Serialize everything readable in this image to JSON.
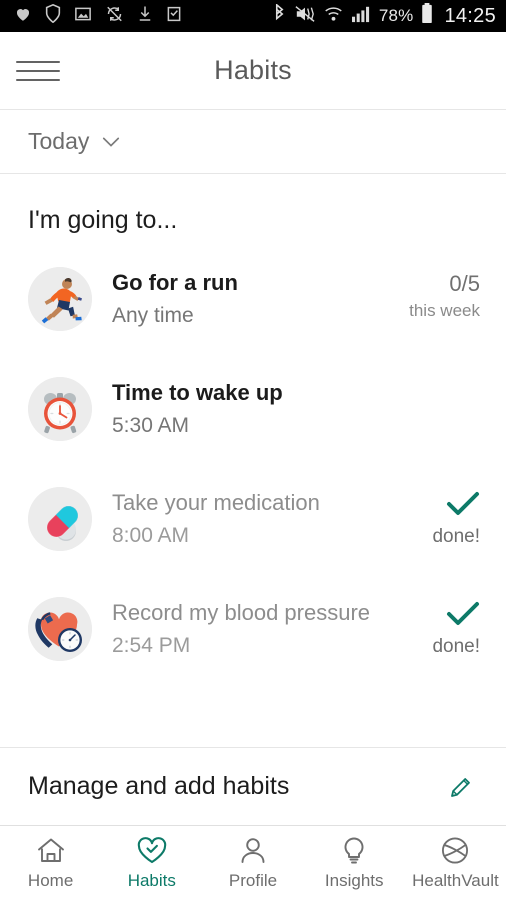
{
  "statusbar": {
    "left_icons": [
      "heart-icon",
      "shield-icon",
      "image-icon",
      "sync-disabled-icon",
      "download-icon",
      "clipboard-check-icon"
    ],
    "right_icons": [
      "bluetooth-icon",
      "vibrate-mute-icon",
      "wifi-icon",
      "cellular-signal-icon"
    ],
    "battery_percent": "78%",
    "battery_icon": "battery-icon",
    "clock": "14:25"
  },
  "appbar": {
    "menu_icon": "hamburger-menu-icon",
    "title": "Habits"
  },
  "datebar": {
    "label": "Today",
    "chevron_icon": "chevron-down-icon"
  },
  "main": {
    "section_title": "I'm going to...",
    "habits": [
      {
        "icon": "running-person-icon",
        "name": "Go for a run",
        "time": "Any time",
        "status_main": "0/5",
        "status_sub": "this week",
        "done": false
      },
      {
        "icon": "alarm-clock-icon",
        "name": "Time to wake up",
        "time": "5:30 AM",
        "status_main": "",
        "status_sub": "",
        "done": false
      },
      {
        "icon": "pill-capsule-icon",
        "name": "Take your medication",
        "time": "8:00 AM",
        "status_main": "check-icon",
        "status_sub": "done!",
        "done": true
      },
      {
        "icon": "blood-pressure-icon",
        "name": "Record my blood pressure",
        "time": "2:54 PM",
        "status_main": "check-icon",
        "status_sub": "done!",
        "done": true
      }
    ]
  },
  "manage": {
    "label": "Manage and add habits",
    "edit_icon": "pencil-edit-icon"
  },
  "bottomnav": {
    "items": [
      {
        "label": "Home",
        "icon": "home-icon",
        "active": false
      },
      {
        "label": "Habits",
        "icon": "heart-check-icon",
        "active": true
      },
      {
        "label": "Profile",
        "icon": "person-icon",
        "active": false
      },
      {
        "label": "Insights",
        "icon": "lightbulb-icon",
        "active": false
      },
      {
        "label": "HealthVault",
        "icon": "healthvault-icon",
        "active": false
      }
    ]
  },
  "colors": {
    "accent_teal": "#0d7a68",
    "icon_orange": "#E8533A",
    "text_primary": "#1d1d1d",
    "text_muted": "#767676",
    "status_bar_bg": "#000000"
  }
}
